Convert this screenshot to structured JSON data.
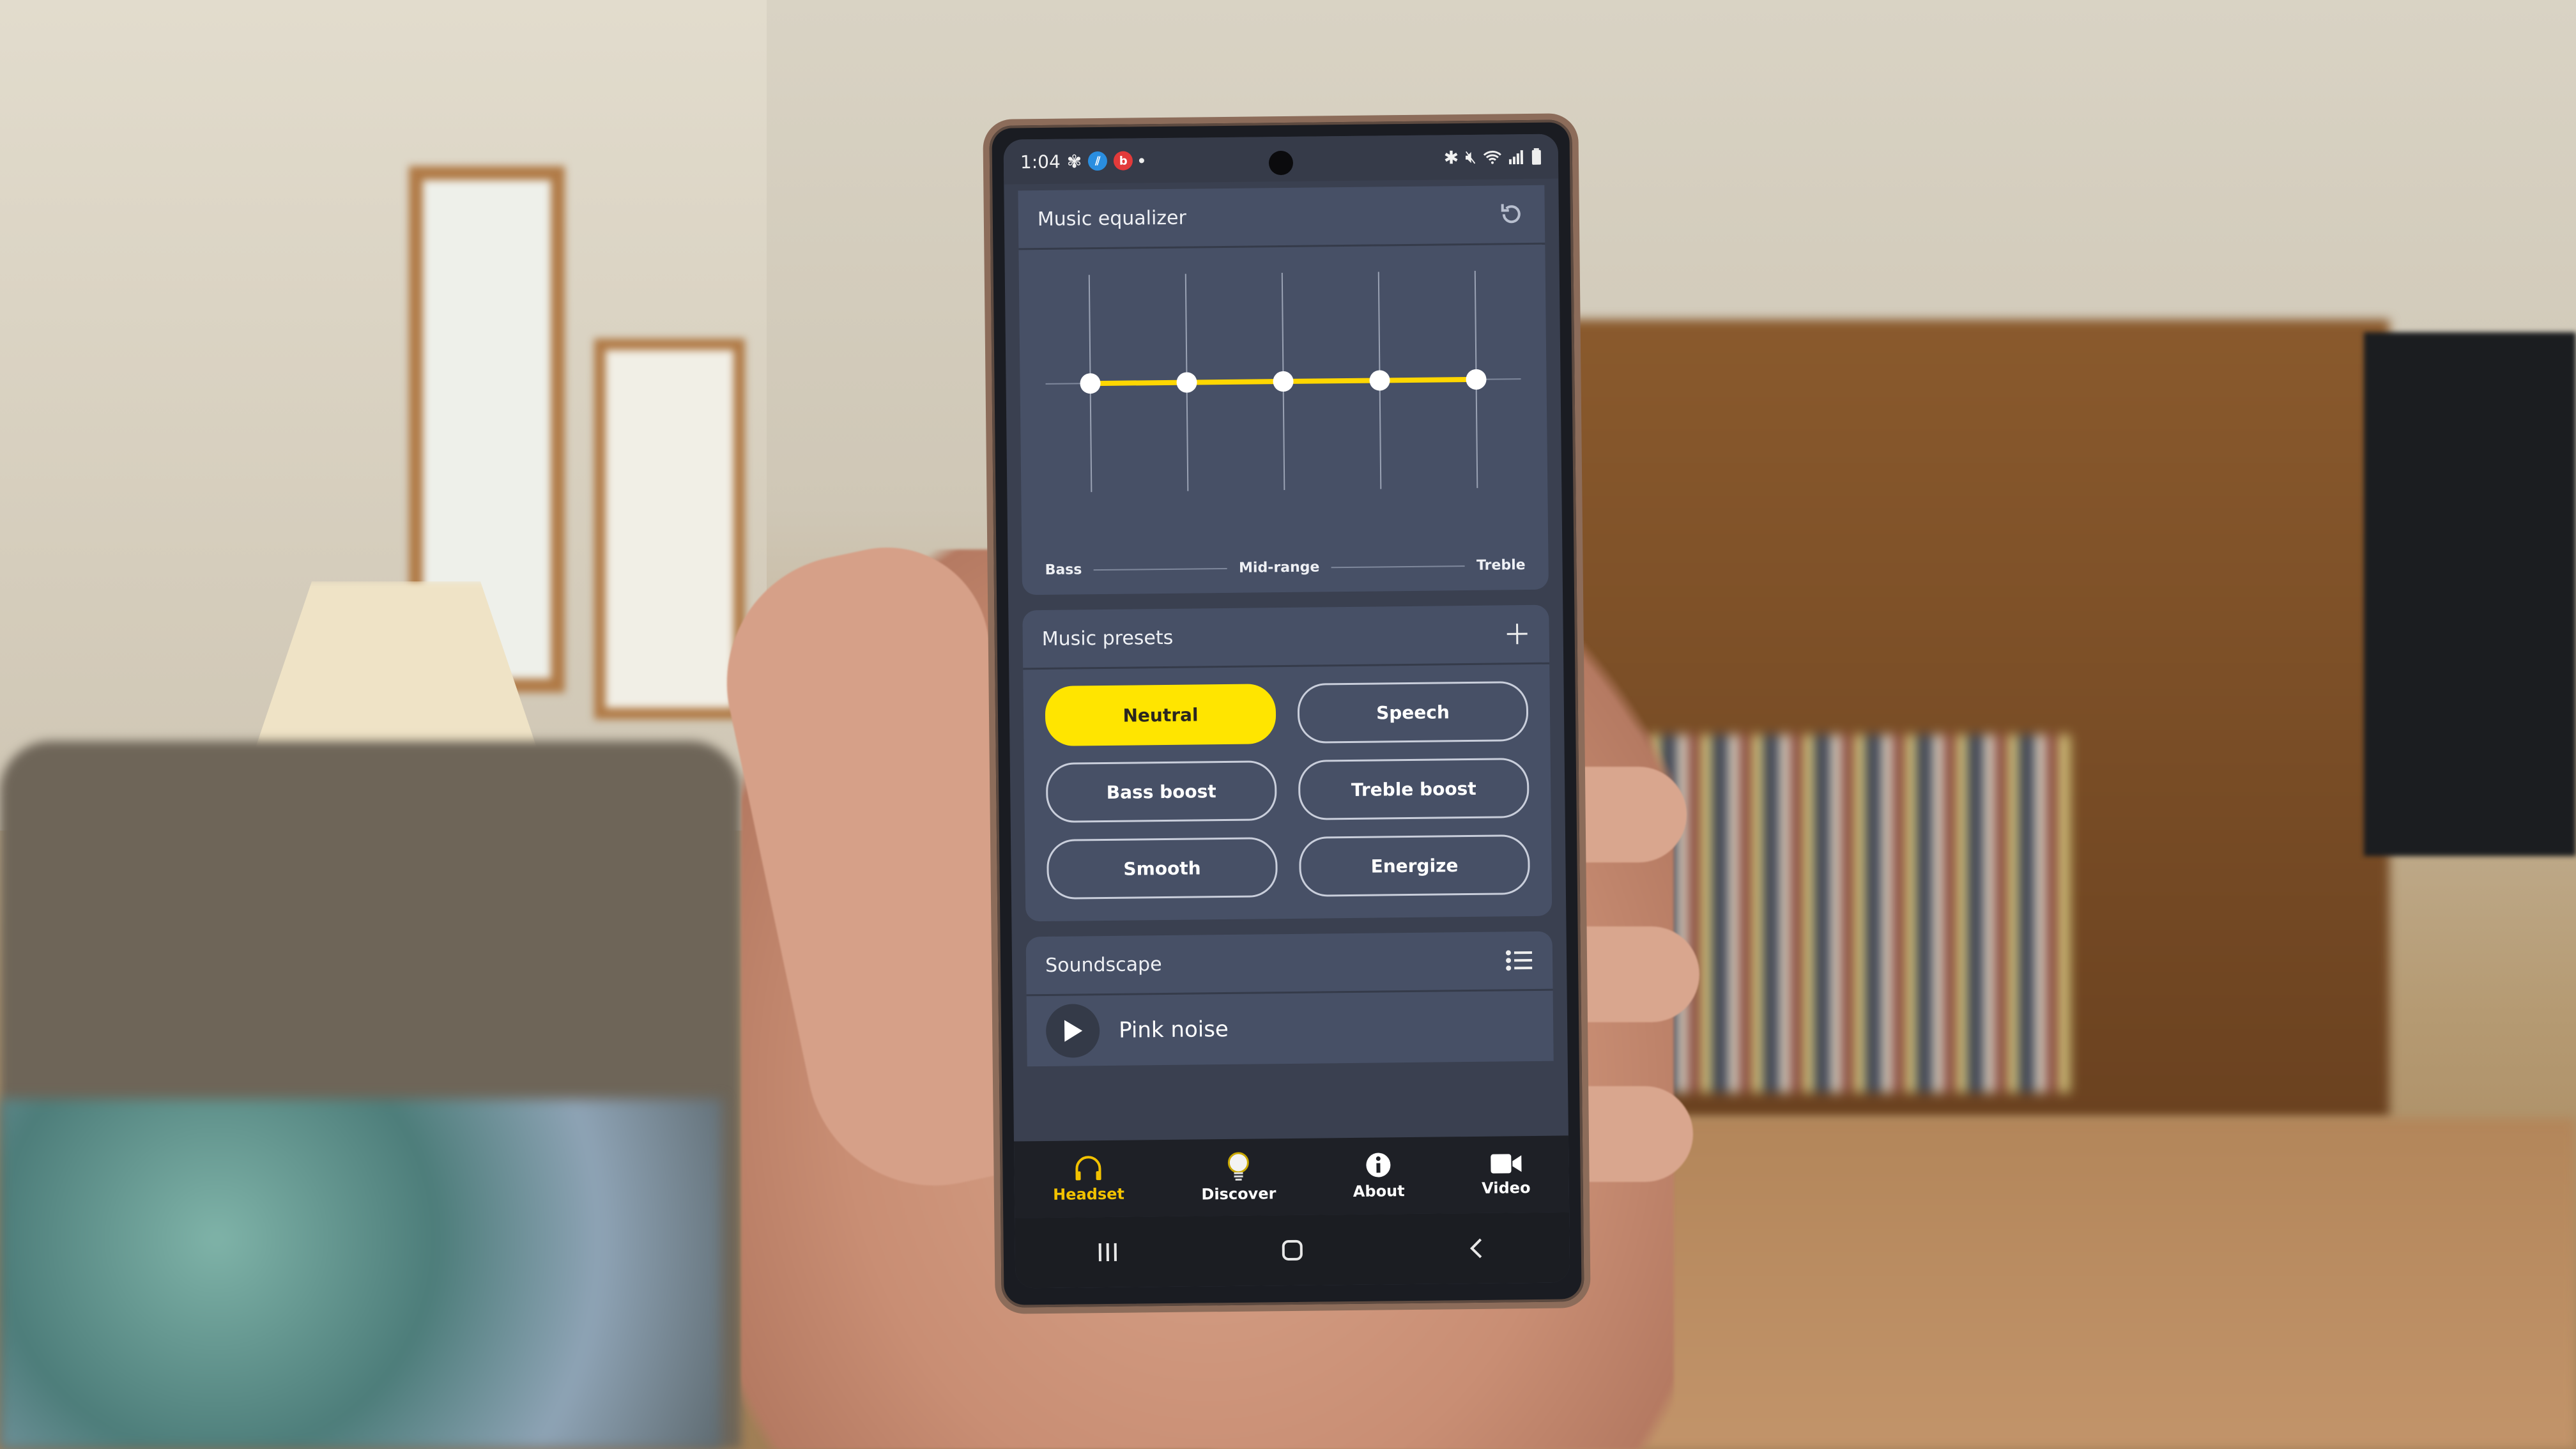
{
  "status_bar": {
    "time": "1:04",
    "left_icons": [
      "pinwheel-icon",
      "app-notification-icon",
      "beats-icon",
      "notification-dot"
    ],
    "right_icons": [
      "bluetooth-icon",
      "mute-icon",
      "wifi-icon",
      "signal-icon",
      "battery-icon"
    ]
  },
  "equalizer": {
    "title": "Music equalizer",
    "reset_icon": "reset-icon",
    "band_labels": {
      "low": "Bass",
      "mid": "Mid-range",
      "high": "Treble"
    },
    "bands": [
      {
        "name": "band-1",
        "level": 0.0
      },
      {
        "name": "band-2",
        "level": 0.0
      },
      {
        "name": "band-3",
        "level": 0.0
      },
      {
        "name": "band-4",
        "level": 0.0
      },
      {
        "name": "band-5",
        "level": 0.0
      }
    ],
    "accent_color": "#ffd700"
  },
  "presets": {
    "title": "Music presets",
    "add_icon": "plus-icon",
    "items": [
      {
        "label": "Neutral",
        "active": true
      },
      {
        "label": "Speech",
        "active": false
      },
      {
        "label": "Bass boost",
        "active": false
      },
      {
        "label": "Treble boost",
        "active": false
      },
      {
        "label": "Smooth",
        "active": false
      },
      {
        "label": "Energize",
        "active": false
      }
    ],
    "active_color": "#ffe500"
  },
  "soundscape": {
    "title": "Soundscape",
    "list_icon": "list-icon",
    "current": "Pink noise",
    "play_icon": "play-icon"
  },
  "bottom_nav": {
    "items": [
      {
        "label": "Headset",
        "icon": "headset-icon",
        "active": true
      },
      {
        "label": "Discover",
        "icon": "lightbulb-icon",
        "active": false
      },
      {
        "label": "About",
        "icon": "info-icon",
        "active": false
      },
      {
        "label": "Video",
        "icon": "video-icon",
        "active": false
      }
    ],
    "active_color": "#f2c200"
  },
  "system_nav": {
    "items": [
      "recents-icon",
      "home-icon",
      "back-icon"
    ]
  }
}
